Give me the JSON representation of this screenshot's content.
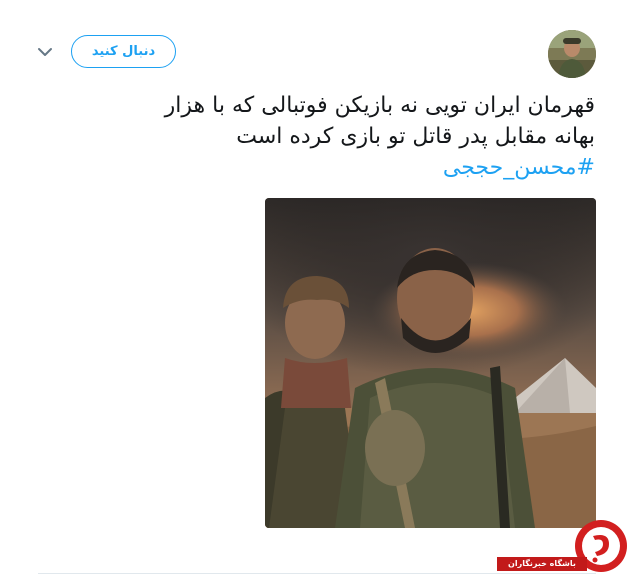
{
  "header": {
    "follow_label": "دنبال کنید"
  },
  "tweet": {
    "line1": "قهرمان ایران تویی نه بازیکن فوتبالی که با هزار",
    "line2": "بهانه مقابل پدر قاتل تو بازی کرده است",
    "hashtag": "#محسن_حججی"
  },
  "watermark": {
    "label": "باشگاه خبرنگاران"
  },
  "icons": {
    "caret": "chevron-down-icon",
    "logo": "news-club-logo"
  },
  "colors": {
    "accent": "#1da1f2",
    "text": "#14171a",
    "divider": "#e1e8ed",
    "watermark": "#c21a1a"
  }
}
